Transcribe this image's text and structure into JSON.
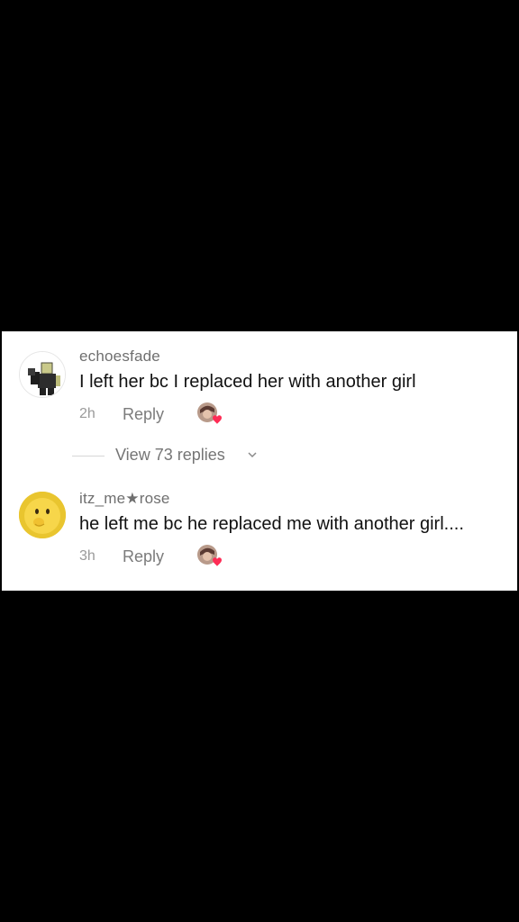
{
  "comments": [
    {
      "username": "echoesfade",
      "text": "I left her bc I replaced her with another girl",
      "time": "2h",
      "reply_label": "Reply",
      "view_replies_label": "View 73 replies"
    },
    {
      "username": "itz_me★rose",
      "text": "he left me bc he replaced me with another girl....",
      "time": "3h",
      "reply_label": "Reply"
    }
  ],
  "colors": {
    "background": "#000000",
    "panel": "#ffffff",
    "heart": "#fe2c55"
  },
  "icons": [
    "roblox-avatar-icon",
    "duck-avatar-icon",
    "creator-liked-icon",
    "chevron-down-icon"
  ]
}
